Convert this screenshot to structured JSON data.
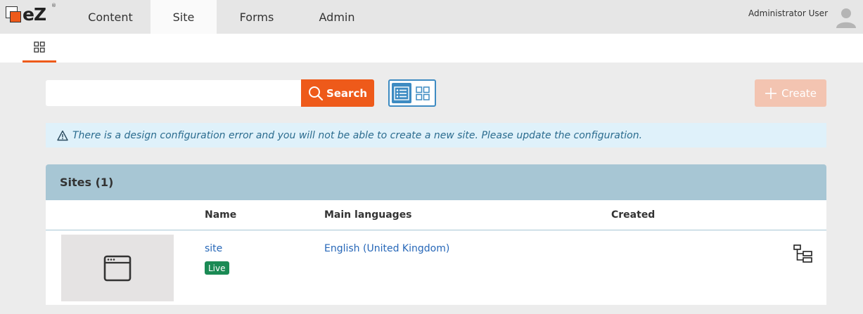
{
  "brand": {
    "logo_text": "eZ",
    "reg_mark": "®"
  },
  "nav": {
    "items": [
      {
        "label": "Content"
      },
      {
        "label": "Site"
      },
      {
        "label": "Forms"
      },
      {
        "label": "Admin"
      }
    ],
    "active": "Site"
  },
  "user": {
    "name": "Administrator User",
    "avatar_icon": "user-avatar-icon"
  },
  "subnav": {
    "icon": "grid-icon"
  },
  "search": {
    "value": "",
    "placeholder": "",
    "button_label": "Search"
  },
  "view_toggle": {
    "selected": "list",
    "icons": [
      "list-view-icon",
      "grid-view-icon"
    ]
  },
  "create": {
    "label": "Create",
    "disabled": true
  },
  "alert": {
    "icon": "warning-icon",
    "text": "There is a design configuration error and you will not be able to create a new site. Please update the configuration."
  },
  "panel": {
    "title": "Sites (1)",
    "columns": [
      "Name",
      "Main languages",
      "Created"
    ],
    "rows": [
      {
        "name": "site",
        "status": "Live",
        "languages": "English (United Kingdom)",
        "created": "",
        "thumb_icon": "browser-window-icon",
        "action_icon": "tree-icon"
      }
    ]
  },
  "colors": {
    "accent": "#ee5a1a",
    "primary_blue": "#3d8bc2",
    "panel_header": "#a7c6d4",
    "alert_bg": "#dff1fa",
    "live_badge": "#1a8a54",
    "link": "#2667b8"
  }
}
